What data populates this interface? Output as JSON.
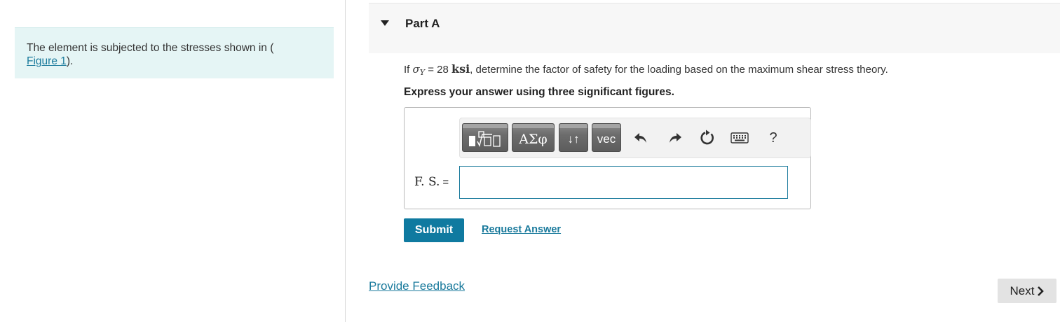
{
  "intro": {
    "text": "The element is subjected to the stresses shown in (",
    "link": "Figure 1",
    "suffix": ")."
  },
  "part": {
    "title": "Part A"
  },
  "question": {
    "prefix": "If ",
    "sigma": "σ",
    "subscript": "Y",
    "equals": " = 28 ",
    "unit": "ksi",
    "suffix": ", determine the factor of safety for the loading based on the maximum shear stress theory.",
    "instruction": "Express your answer using three significant figures."
  },
  "toolbar": {
    "greek_label": "ΑΣφ",
    "arrows_label": "↓↑",
    "vec_label": "vec",
    "help_label": "?",
    "icons": [
      "templates-icon",
      "undo-icon",
      "redo-icon",
      "reset-icon",
      "keyboard-icon",
      "help-icon"
    ]
  },
  "answer": {
    "label": "F. S.",
    "equals": "=",
    "value": ""
  },
  "actions": {
    "submit_label": "Submit",
    "request_label": "Request Answer",
    "feedback_label": "Provide Feedback",
    "next_label": "Next"
  },
  "colors": {
    "accent": "#0f7aa0",
    "link": "#1a7a9c",
    "intro_bg": "#e5f5f5",
    "header_bg": "#f7f7f7"
  }
}
